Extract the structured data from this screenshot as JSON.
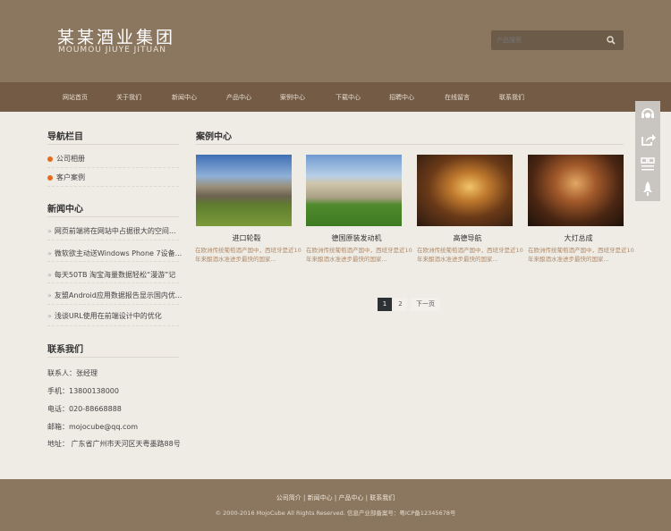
{
  "header": {
    "logo_cn": "某某酒业集团",
    "logo_en": "MOUMOU JIUYE JITUAN",
    "search_placeholder": "产品搜索"
  },
  "nav": [
    "网站首页",
    "关于我们",
    "新闻中心",
    "产品中心",
    "案例中心",
    "下载中心",
    "招聘中心",
    "在线留言",
    "联系我们"
  ],
  "sidebar": {
    "nav_title": "导航栏目",
    "nav_items": [
      "公司相册",
      "客户案例"
    ],
    "news_title": "新闻中心",
    "news": [
      "网页前端将在网站中占据很大的空间...",
      "微软欲主动送Windows Phone 7设备...",
      "每天50TB 淘宝海量数据轻松“漫游”记",
      "友盟Android应用数据报告显示国内优...",
      "浅谈URL使用在前端设计中的优化"
    ],
    "contact_title": "联系我们",
    "contacts": [
      "联系人：张经理",
      "手机：13800138000",
      "电话：020-88668888",
      "邮箱：mojocube@qq.com",
      "地址： 广东省广州市天河区天粤墨路88号"
    ]
  },
  "main": {
    "title": "案例中心",
    "cases": [
      {
        "title": "进口轮毂",
        "desc": "在欧洲传统葡萄酒产国中，西班牙是近10年来酿酒水准进步最快的国家..."
      },
      {
        "title": "德国原装发动机",
        "desc": "在欧洲传统葡萄酒产国中，西班牙是近10年来酿酒水准进步最快的国家..."
      },
      {
        "title": "高德导航",
        "desc": "在欧洲传统葡萄酒产国中，西班牙是近10年来酿酒水准进步最快的国家..."
      },
      {
        "title": "大灯总成",
        "desc": "在欧洲传统葡萄酒产国中，西班牙是近10年来酿酒水准进步最快的国家..."
      }
    ],
    "pagination": {
      "pages": [
        "1",
        "2"
      ],
      "current": "1",
      "next": "下一页"
    }
  },
  "footer": {
    "links": [
      "公司简介",
      "新闻中心",
      "产品中心",
      "联系我们"
    ],
    "copyright": "© 2000-2016 MojoCube All Rights Reserved. 信息产业部备案号：粤ICP备12345678号"
  }
}
